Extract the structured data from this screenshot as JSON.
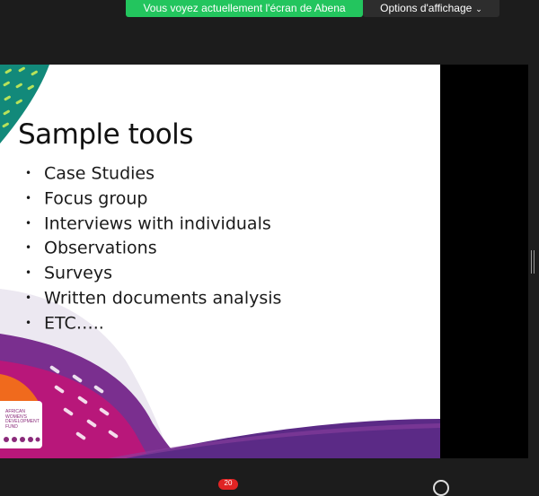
{
  "banner": {
    "text": "Vous voyez actuellement l'écran de Abena"
  },
  "view_options": {
    "label": "Options d'affichage",
    "chevron": "chevron-down-icon"
  },
  "slide": {
    "title": "Sample tools",
    "bullets": [
      "Case Studies",
      "Focus group",
      "Interviews with individuals",
      "Observations",
      "Surveys",
      "Written documents analysis",
      "ETC….."
    ],
    "logo_lines": [
      "AFRICAN",
      "WOMEN'S",
      "DEVELOPMENT",
      "FUND"
    ]
  },
  "toolbar": {
    "chat_badge": "20"
  },
  "colors": {
    "banner": "#23c55e",
    "teal": "#12897a",
    "purple": "#5b2a86",
    "magenta": "#b8177a",
    "orange": "#f06a1d",
    "lilac": "#e9e4ef"
  }
}
